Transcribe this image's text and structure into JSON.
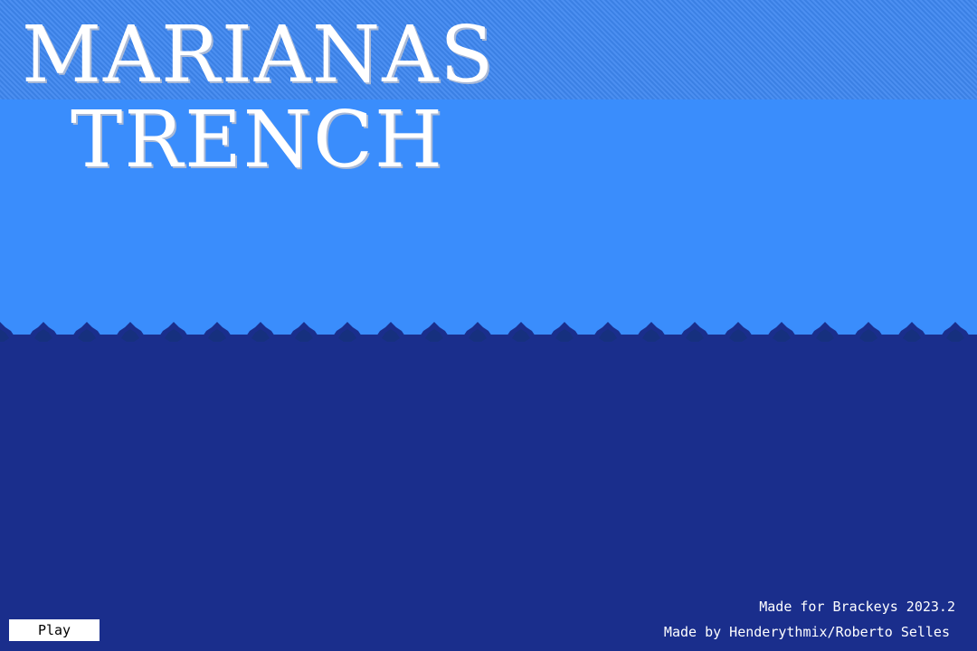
{
  "title": {
    "line1": "MARIANAS",
    "line2": "TRENCH"
  },
  "credits": {
    "line1": "Made for Brackeys 2023.2",
    "line2": "Made by Henderythmix/Roberto Selles"
  },
  "menu": {
    "play_label": "Play"
  },
  "colors": {
    "sky_top": "#3e87f0",
    "sky": "#3a8dfc",
    "sea": "#1a2e8c",
    "wave_crest": "#16307e",
    "text": "#ffffff",
    "button_bg": "#ffffff",
    "button_text": "#000000"
  }
}
